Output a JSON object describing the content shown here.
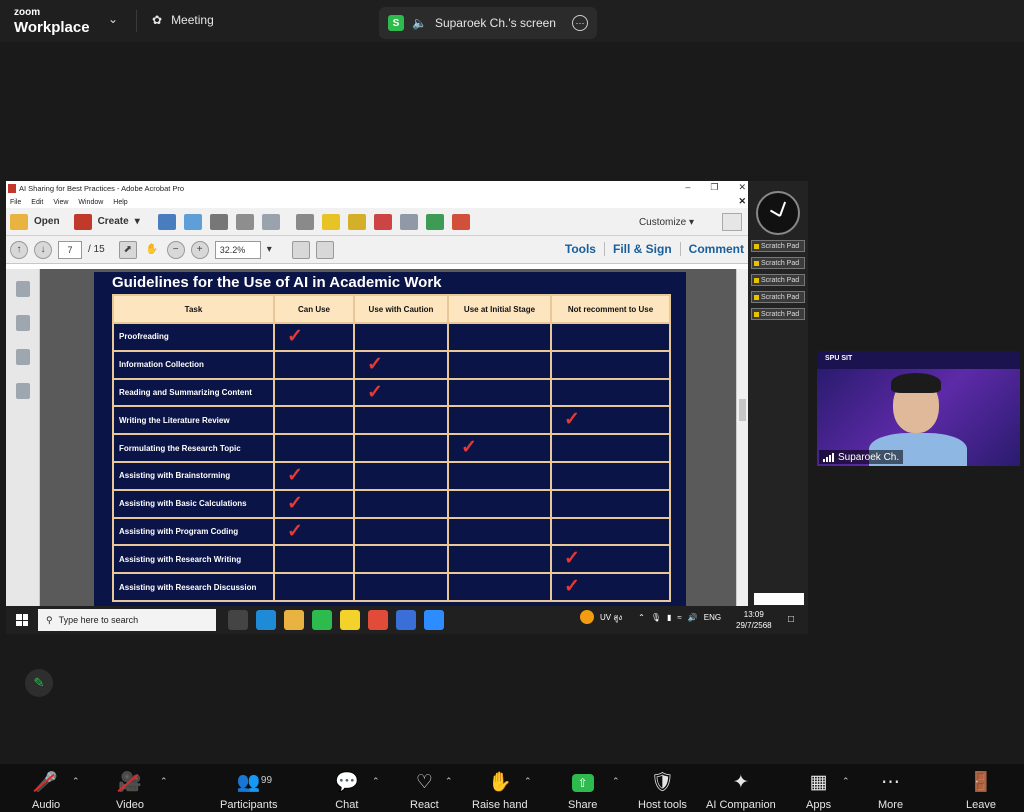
{
  "app": {
    "brand_top": "zoom",
    "brand_bottom": "Workplace",
    "meeting_label": "Meeting"
  },
  "screen_share": {
    "badge": "S",
    "label": "Suparoek Ch.'s screen"
  },
  "acrobat": {
    "window_title": "AI Sharing for Best Practices - Adobe Acrobat Pro",
    "menu": [
      "File",
      "Edit",
      "View",
      "Window",
      "Help"
    ],
    "open_label": "Open",
    "create_label": "Create",
    "customize_label": "Customize",
    "page_current": "7",
    "page_total": "/ 15",
    "zoom": "32.2%",
    "tabs": [
      "Tools",
      "Fill & Sign",
      "Comment"
    ]
  },
  "slide": {
    "title": "Guidelines for the Use of AI in Academic Work",
    "columns": [
      "Task",
      "Can Use",
      "Use with Caution",
      "Use at Initial Stage",
      "Not recomment to Use"
    ],
    "rows": [
      {
        "task": "Proofreading",
        "rating": 1
      },
      {
        "task": "Information Collection",
        "rating": 2
      },
      {
        "task": "Reading and Summarizing Content",
        "rating": 2
      },
      {
        "task": "Writing the Literature Review",
        "rating": 4
      },
      {
        "task": "Formulating the Research Topic",
        "rating": 3
      },
      {
        "task": "Assisting with Brainstorming",
        "rating": 1
      },
      {
        "task": "Assisting with Basic Calculations",
        "rating": 1
      },
      {
        "task": "Assisting with Program Coding",
        "rating": 1
      },
      {
        "task": "Assisting with Research Writing",
        "rating": 4
      },
      {
        "task": "Assisting with Research Discussion",
        "rating": 4
      }
    ],
    "check_glyph": "✓"
  },
  "side_panel": {
    "scratch_pads": [
      "Scratch Pad",
      "Scratch Pad",
      "Scratch Pad",
      "Scratch Pad",
      "Scratch Pad"
    ]
  },
  "taskbar": {
    "search_placeholder": "Type here to search",
    "uv_label": "UV สูง",
    "lang": "ENG",
    "time": "13:09",
    "date": "29/7/2568"
  },
  "video": {
    "participant_name": "Suparoek Ch.",
    "banner_logo": "SPU SIT"
  },
  "toolbar": {
    "audio": "Audio",
    "video": "Video",
    "participants": "Participants",
    "participants_count": "99",
    "chat": "Chat",
    "react": "React",
    "raise_hand": "Raise hand",
    "share": "Share",
    "host_tools": "Host tools",
    "ai_companion": "AI Companion",
    "apps": "Apps",
    "more": "More",
    "leave": "Leave"
  },
  "colors": {
    "slide_bg": "#0b1446",
    "header_bg": "#fde5c0",
    "check": "#e53935",
    "share_green": "#2dbb4e",
    "link_blue": "#1a5e9a"
  }
}
